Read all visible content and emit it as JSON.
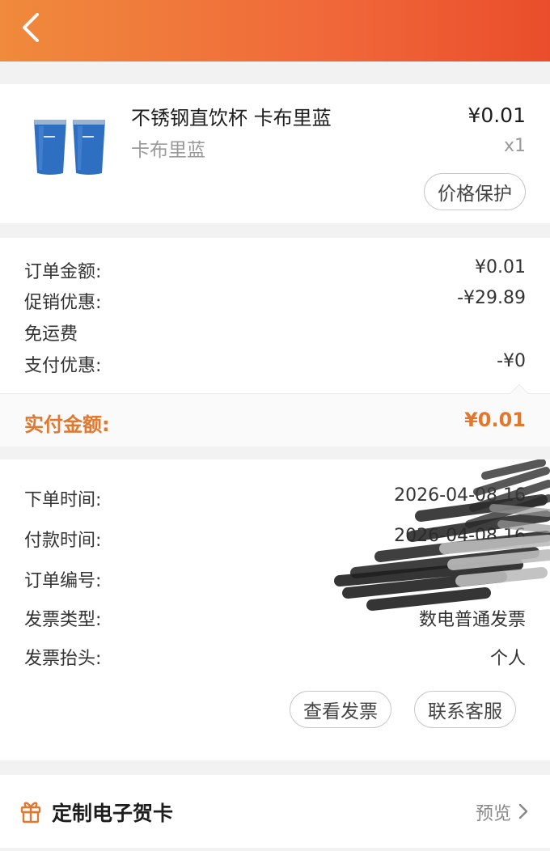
{
  "product": {
    "name": "不锈钢直饮杯 卡布里蓝",
    "variant": "卡布里蓝",
    "price": "¥0.01",
    "quantity": "x1",
    "price_protect_label": "价格保护"
  },
  "amounts": {
    "rows": [
      {
        "label": "订单金额:",
        "value": "¥0.01"
      },
      {
        "label": "促销优惠:",
        "value": "-¥29.89"
      },
      {
        "label": "免运费",
        "value": ""
      },
      {
        "label": "支付优惠:",
        "value": "-¥0"
      }
    ],
    "actual_label": "实付金额:",
    "actual_value": "¥0.01"
  },
  "order_info": {
    "rows": [
      {
        "label": "下单时间:",
        "value": "2026-04-08 16"
      },
      {
        "label": "付款时间:",
        "value": "2026-04-08 16"
      },
      {
        "label": "订单编号:",
        "value": ""
      },
      {
        "label": "发票类型:",
        "value": "数电普通发票"
      },
      {
        "label": "发票抬头:",
        "value": "个人"
      }
    ],
    "view_invoice_label": "查看发票",
    "contact_service_label": "联系客服"
  },
  "greeting_card": {
    "title": "定制电子贺卡",
    "preview_label": "预览"
  },
  "colors": {
    "header_gradient_start": "#f08a3c",
    "header_gradient_end": "#ea4d2b",
    "accent_orange": "#e0782f",
    "cup_blue": "#2f6fc2"
  },
  "icons": [
    "back-icon",
    "gift-icon",
    "chevron-right-icon"
  ]
}
